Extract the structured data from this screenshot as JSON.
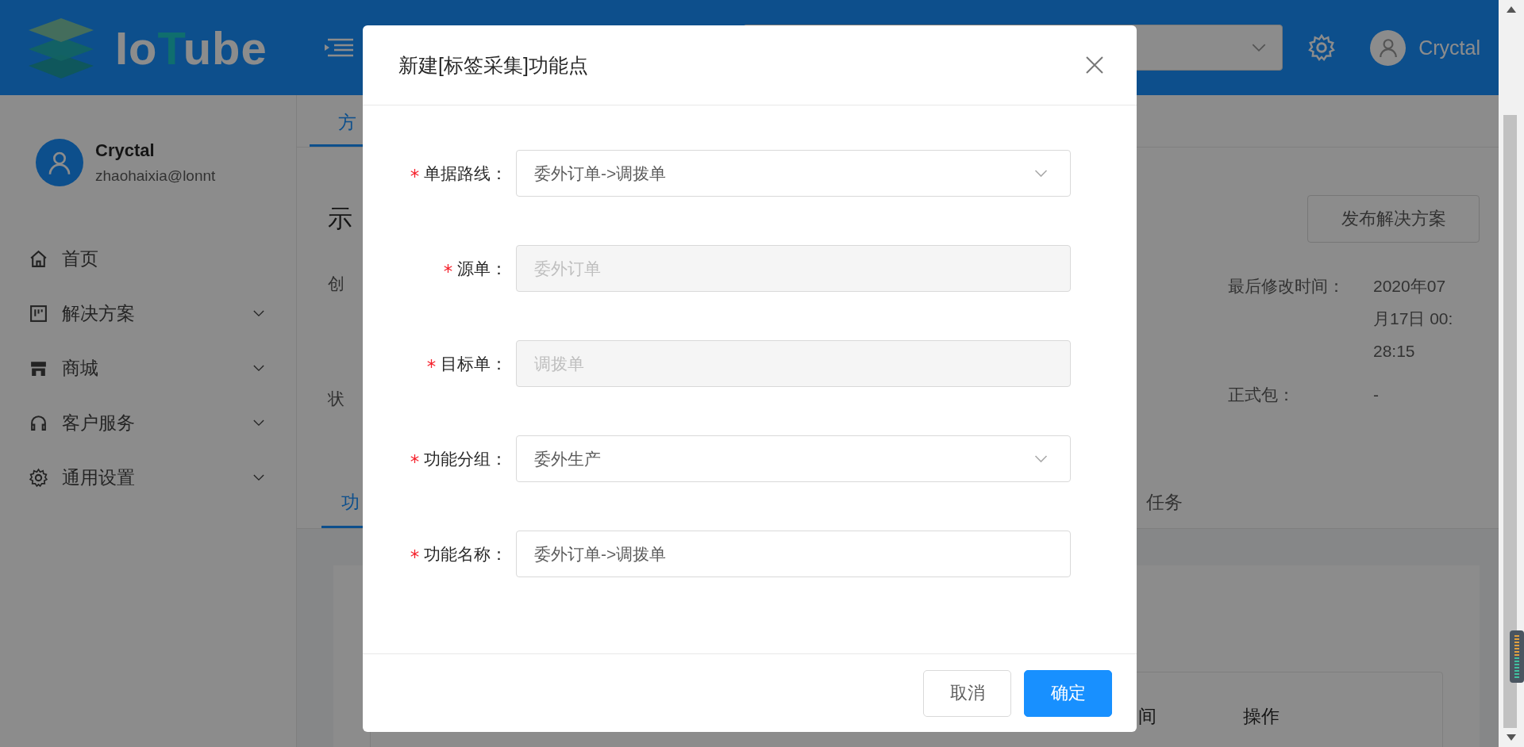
{
  "header": {
    "logo_parts": [
      {
        "text": "Io",
        "accent": false
      },
      {
        "text": "T",
        "accent": true
      },
      {
        "text": "ube",
        "accent": false
      }
    ],
    "user_name": "Cryctal"
  },
  "sidebar": {
    "user": {
      "name": "Cryctal",
      "email": "zhaohaixia@lonnt"
    },
    "items": [
      {
        "label": "首页",
        "kind": "link"
      },
      {
        "label": "解决方案",
        "kind": "submenu"
      },
      {
        "label": "商城",
        "kind": "submenu"
      },
      {
        "label": "客户服务",
        "kind": "submenu"
      },
      {
        "label": "通用设置",
        "kind": "submenu"
      }
    ]
  },
  "content": {
    "tabs": [
      {
        "label": "方",
        "selected": true
      }
    ],
    "title": "示",
    "publish_button": "发布解决方案",
    "left_labels": [
      "创",
      "状"
    ],
    "fields": [
      {
        "label": "最后修改时间：",
        "value": "2020年07月17日 00:28:15"
      },
      {
        "label": "正式包：",
        "value": "-"
      }
    ],
    "detail_tabs": [
      {
        "label": "功",
        "selected": true
      },
      {
        "label": "任务",
        "selected": false
      }
    ],
    "table": {
      "columns": [
        "间",
        "操作"
      ]
    }
  },
  "modal": {
    "title": "新建[标签采集]功能点",
    "fields": [
      {
        "label": "单据路线：",
        "required": true,
        "kind": "select",
        "value": "委外订单->调拨单",
        "disabled": false
      },
      {
        "label": "源单：",
        "required": true,
        "kind": "input",
        "value": "委外订单",
        "disabled": true
      },
      {
        "label": "目标单：",
        "required": true,
        "kind": "input",
        "value": "调拨单",
        "disabled": true
      },
      {
        "label": "功能分组：",
        "required": true,
        "kind": "select",
        "value": "委外生产",
        "disabled": false
      },
      {
        "label": "功能名称：",
        "required": true,
        "kind": "input",
        "value": "委外订单->调拨单",
        "disabled": false
      }
    ],
    "buttons": [
      {
        "label": "取消",
        "kind": "default"
      },
      {
        "label": "确定",
        "kind": "primary"
      }
    ]
  }
}
